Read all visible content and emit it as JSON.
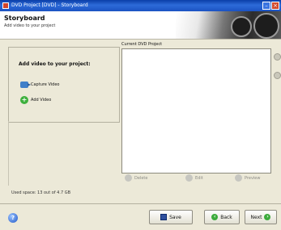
{
  "window": {
    "title": "DVD Project [DVD] - Storyboard"
  },
  "header": {
    "title": "Storyboard",
    "subtitle": "Add video to your project"
  },
  "left_panel": {
    "title": "Add video to your project:",
    "items": [
      {
        "label": "Capture Video",
        "icon": "camera-icon"
      },
      {
        "label": "Add Video",
        "icon": "add-video-icon"
      }
    ]
  },
  "project": {
    "label": "Current DVD Project"
  },
  "actions": [
    "Delete",
    "Edit",
    "Preview"
  ],
  "status": {
    "disk_usage": "Used space: 13 out of 4.7 GB"
  },
  "buttons": {
    "save": "Save",
    "back": "Back",
    "next": "Next"
  }
}
